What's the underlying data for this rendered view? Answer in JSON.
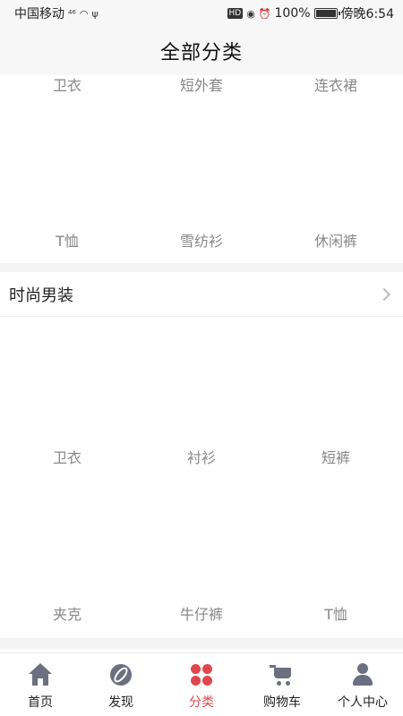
{
  "status_bar": {
    "carrier": "中国移动",
    "signal": "⁴⁶",
    "battery": "100%",
    "time": "傍晚6:54"
  },
  "header": {
    "title": "全部分类"
  },
  "top_partial": {
    "labels_top": [
      "卫衣",
      "短外套",
      "连衣裙"
    ],
    "labels_bottom": [
      "T恤",
      "雪纺衫",
      "休闲裤"
    ]
  },
  "section_men": {
    "title": "时尚男装",
    "row1": [
      "卫衣",
      "衬衫",
      "短裤"
    ],
    "row2": [
      "夹克",
      "牛仔裤",
      "T恤"
    ]
  },
  "tabbar": {
    "tabs": [
      {
        "label": "首页",
        "icon": "home-icon"
      },
      {
        "label": "发现",
        "icon": "discover-icon"
      },
      {
        "label": "分类",
        "icon": "category-icon"
      },
      {
        "label": "购物车",
        "icon": "cart-icon"
      },
      {
        "label": "个人中心",
        "icon": "user-icon"
      }
    ],
    "active_color": "#e0474c",
    "active_index": 2
  }
}
